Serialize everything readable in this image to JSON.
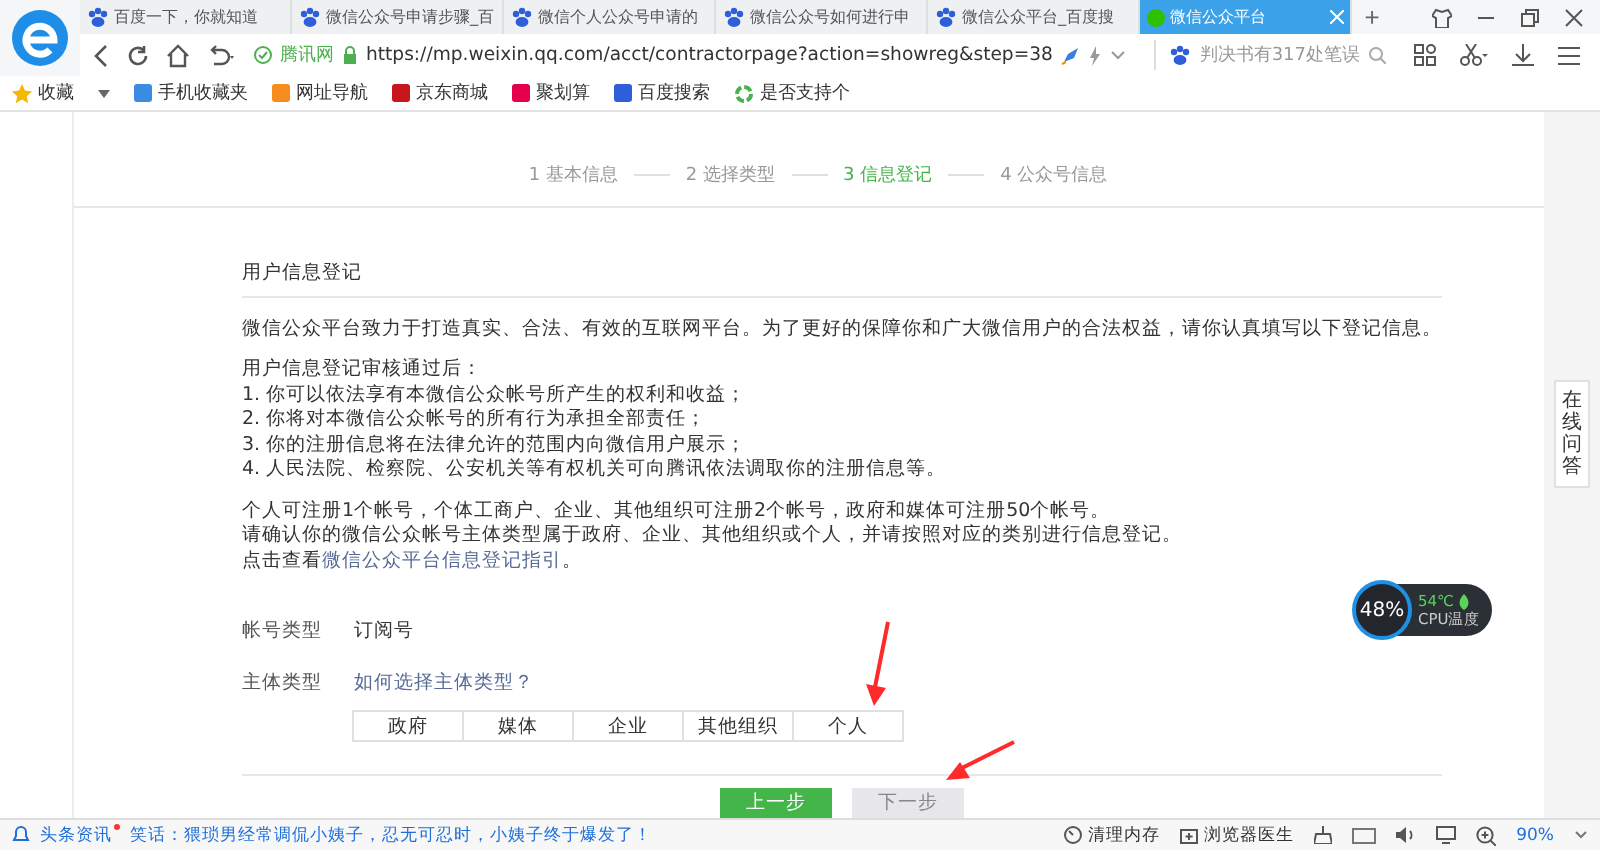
{
  "browser": {
    "tabs": [
      {
        "title": "百度一下，你就知道",
        "selected": false
      },
      {
        "title": "微信公众号申请步骤_百",
        "selected": false
      },
      {
        "title": "微信个人公众号申请的",
        "selected": false
      },
      {
        "title": "微信公众号如何进行申",
        "selected": false
      },
      {
        "title": "微信公众平台_百度搜",
        "selected": false
      },
      {
        "title": "微信公众平台",
        "selected": true
      }
    ],
    "new_tab": "+",
    "site_badge": "腾讯网",
    "url": "https://mp.weixin.qq.com/acct/contractorpage?action=showreg&step=38",
    "search_placeholder": "判决书有317处笔误",
    "bookmarks": [
      "收藏",
      "手机收藏夹",
      "网址导航",
      "京东商城",
      "聚划算",
      "百度搜索",
      "是否支持个"
    ]
  },
  "steps": [
    {
      "label": "1 基本信息",
      "selected": false
    },
    {
      "label": "2 选择类型",
      "selected": false
    },
    {
      "label": "3 信息登记",
      "selected": true
    },
    {
      "label": "4 公众号信息",
      "selected": false
    }
  ],
  "section_title": "用户信息登记",
  "intro": "微信公众平台致力于打造真实、合法、有效的互联网平台。为了更好的保障你和广大微信用户的合法权益，请你认真填写以下登记信息。",
  "review_heading": "用户信息登记审核通过后：",
  "review_items": [
    "1. 你可以依法享有本微信公众帐号所产生的权利和收益；",
    "2. 你将对本微信公众帐号的所有行为承担全部责任；",
    "3. 你的注册信息将在法律允许的范围内向微信用户展示；",
    "4. 人民法院、检察院、公安机关等有权机关可向腾讯依法调取你的注册信息等。"
  ],
  "rules": [
    "个人可注册1个帐号，个体工商户、企业、其他组织可注册2个帐号，政府和媒体可注册50个帐号。",
    "请确认你的微信公众帐号主体类型属于政府、企业、其他组织或个人，并请按照对应的类别进行信息登记。"
  ],
  "guide": {
    "before": "点击查看",
    "link": "微信公众平台信息登记指引",
    "after": "。"
  },
  "account_type": {
    "label": "帐号类型",
    "value": "订阅号"
  },
  "subject_type": {
    "label": "主体类型",
    "help_link": "如何选择主体类型？",
    "options": [
      {
        "label": "政府",
        "selected": false
      },
      {
        "label": "媒体",
        "selected": false
      },
      {
        "label": "企业",
        "selected": false
      },
      {
        "label": "其他组织",
        "selected": false
      },
      {
        "label": "个人",
        "selected": false
      }
    ]
  },
  "buttons": [
    {
      "label": "上一步",
      "disabled": false
    },
    {
      "label": "下一步",
      "disabled": true
    }
  ],
  "side_tab": "在线问答",
  "cpu_widget": {
    "usage": "48%",
    "temperature": "54℃",
    "caption": "CPU温度"
  },
  "status_bar": {
    "news_label": "头条资讯",
    "news_text": "笑话：猥琐男经常调侃小姨子，忍无可忍时，小姨子终于爆发了！",
    "clean_memory": "清理内存",
    "doctor": "浏览器医生",
    "zoom": "90%"
  }
}
